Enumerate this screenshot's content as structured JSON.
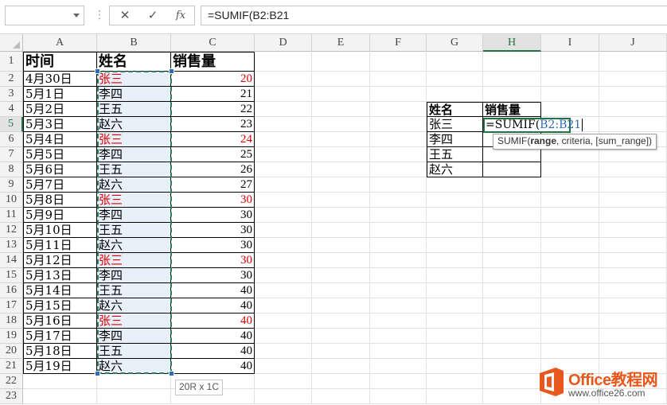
{
  "formula_bar": {
    "name_box": "",
    "cancel_icon": "✕",
    "enter_icon": "✓",
    "fx_label": "fx",
    "formula": "=SUMIF(B2:B21"
  },
  "columns": [
    "A",
    "B",
    "C",
    "D",
    "E",
    "F",
    "G",
    "H",
    "I",
    "J"
  ],
  "rows": [
    "1",
    "2",
    "3",
    "4",
    "5",
    "6",
    "7",
    "8",
    "9",
    "10",
    "11",
    "12",
    "13",
    "14",
    "15",
    "16",
    "17",
    "18",
    "19",
    "20",
    "21",
    "22",
    "23"
  ],
  "table1": {
    "headers": [
      "时间",
      "姓名",
      "销售量"
    ],
    "rows": [
      {
        "date": "4月30日",
        "name": "张三",
        "qty": "20"
      },
      {
        "date": "5月1日",
        "name": "李四",
        "qty": "21"
      },
      {
        "date": "5月2日",
        "name": "王五",
        "qty": "22"
      },
      {
        "date": "5月3日",
        "name": "赵六",
        "qty": "23"
      },
      {
        "date": "5月4日",
        "name": "张三",
        "qty": "24"
      },
      {
        "date": "5月5日",
        "name": "李四",
        "qty": "25"
      },
      {
        "date": "5月6日",
        "name": "王五",
        "qty": "26"
      },
      {
        "date": "5月7日",
        "name": "赵六",
        "qty": "27"
      },
      {
        "date": "5月8日",
        "name": "张三",
        "qty": "30"
      },
      {
        "date": "5月9日",
        "name": "李四",
        "qty": "30"
      },
      {
        "date": "5月10日",
        "name": "王五",
        "qty": "30"
      },
      {
        "date": "5月11日",
        "name": "赵六",
        "qty": "30"
      },
      {
        "date": "5月12日",
        "name": "张三",
        "qty": "30"
      },
      {
        "date": "5月13日",
        "name": "李四",
        "qty": "30"
      },
      {
        "date": "5月14日",
        "name": "王五",
        "qty": "40"
      },
      {
        "date": "5月15日",
        "name": "赵六",
        "qty": "40"
      },
      {
        "date": "5月16日",
        "name": "张三",
        "qty": "40"
      },
      {
        "date": "5月17日",
        "name": "李四",
        "qty": "40"
      },
      {
        "date": "5月18日",
        "name": "王五",
        "qty": "40"
      },
      {
        "date": "5月19日",
        "name": "赵六",
        "qty": "40"
      }
    ]
  },
  "table2": {
    "headers": [
      "姓名",
      "销售量"
    ],
    "names": [
      "张三",
      "李四",
      "王五",
      "赵六"
    ]
  },
  "edit_cell": {
    "prefix": "=SUMIF(",
    "ref": "B2:B21"
  },
  "tooltip": {
    "func": "SUMIF(",
    "arg1": "range",
    "rest": ", criteria, [sum_range])"
  },
  "size_hint": "20R x 1C",
  "logo": {
    "title": "Office教程网",
    "url": "www.office26.com"
  },
  "colors": {
    "highlight_red": "#e00000",
    "selection_green": "#217346",
    "logo_orange": "#e8571b"
  },
  "active_cell": "H5",
  "active_column": "H",
  "active_row": "5"
}
